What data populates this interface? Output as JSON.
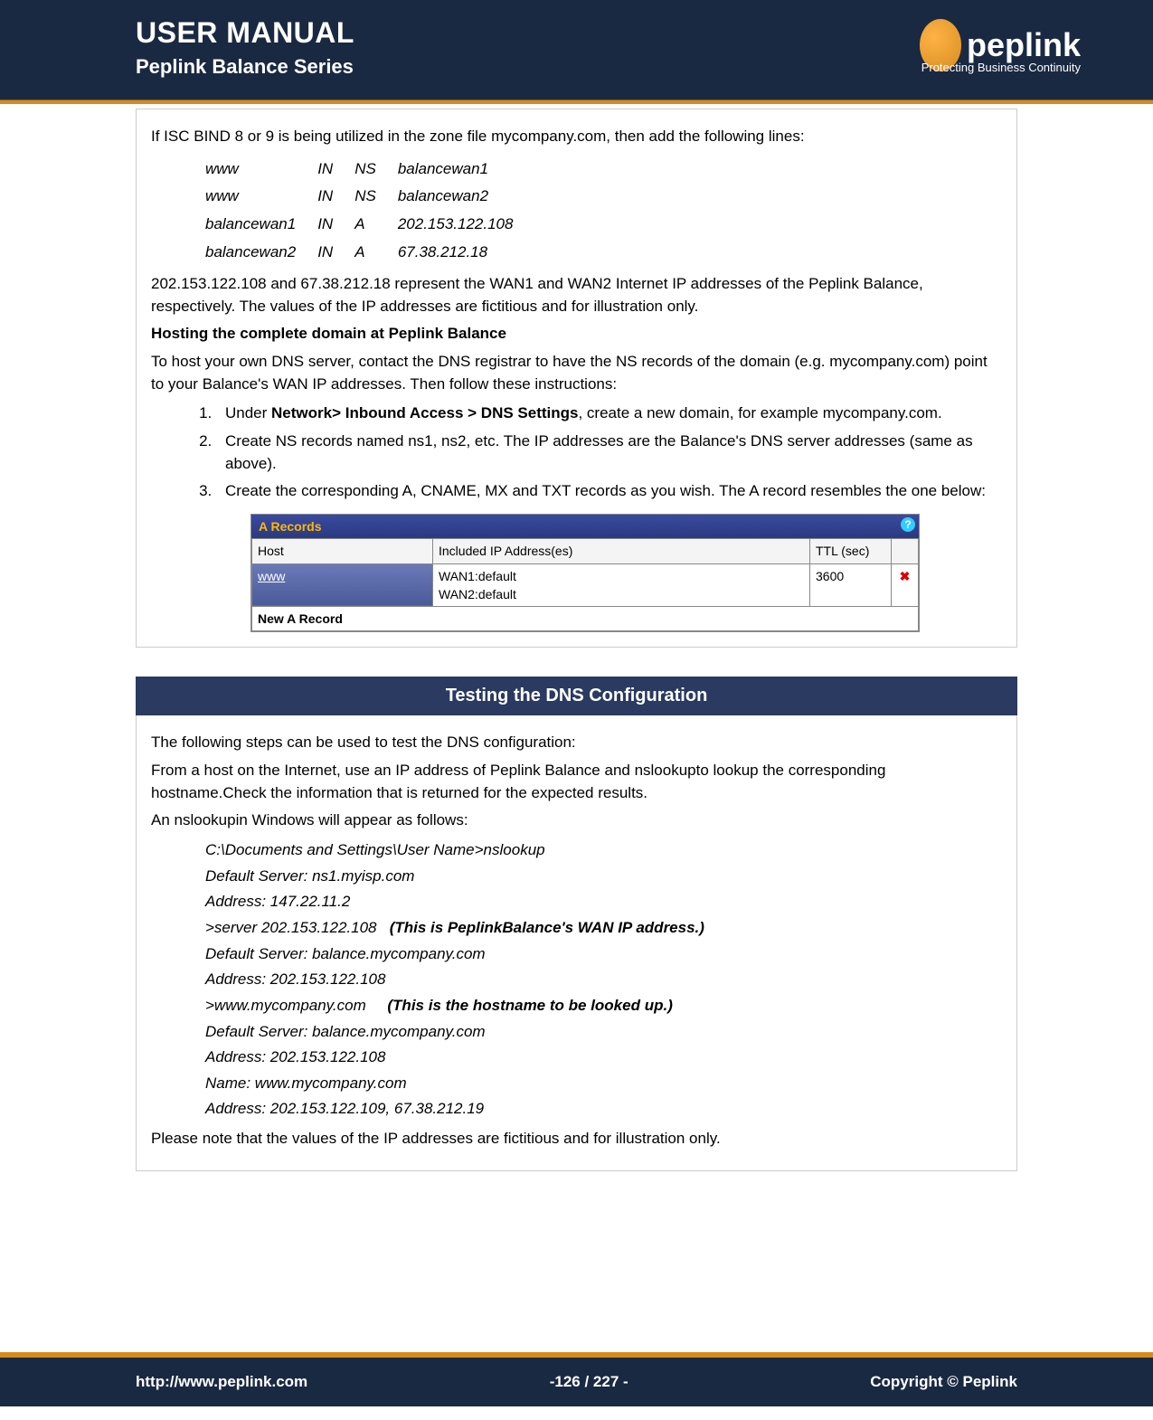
{
  "header": {
    "title": "USER MANUAL",
    "subtitle": "Peplink Balance Series",
    "logo_text": "peplink",
    "logo_tagline": "Protecting Business Continuity"
  },
  "box1": {
    "intro": "If ISC BIND 8 or 9 is being utilized in the zone file mycompany.com, then add the following lines:",
    "bind_rows": [
      {
        "host": "www",
        "in": "IN",
        "type": "NS",
        "val": "balancewan1"
      },
      {
        "host": "www",
        "in": "IN",
        "type": "NS",
        "val": "balancewan2"
      },
      {
        "host": "balancewan1",
        "in": "IN",
        "type": "A",
        "val": "202.153.122.108"
      },
      {
        "host": "balancewan2",
        "in": "IN",
        "type": "A",
        "val": "67.38.212.18"
      }
    ],
    "after_table": "202.153.122.108 and 67.38.212.18 represent the WAN1 and WAN2 Internet IP addresses of the Peplink Balance, respectively. The values of the IP addresses are fictitious and for illustration only.",
    "subheading": "Hosting the complete domain at Peplink Balance",
    "subintro": "To host your own DNS server, contact the DNS registrar to have the NS records of the domain (e.g. mycompany.com) point to your Balance's WAN IP addresses. Then follow these instructions:",
    "steps": {
      "s1_pre": "Under ",
      "s1_bold": "Network> Inbound Access > DNS Settings",
      "s1_post": ", create a new domain, for example mycompany.com.",
      "s2": "Create NS records named ns1, ns2, etc. The IP addresses are the Balance's DNS server addresses (same as above).",
      "s3": "Create the corresponding A, CNAME, MX and TXT records as you wish. The A record resembles the one below:"
    },
    "arec": {
      "title": "A Records",
      "col_host": "Host",
      "col_ip": "Included IP Address(es)",
      "col_ttl": "TTL (sec)",
      "row_host": "www",
      "row_ip": "WAN1:default\nWAN2:default",
      "row_ttl": "3600",
      "new_btn": "New A Record",
      "help": "?"
    }
  },
  "banner2": "Testing the DNS Configuration",
  "box2": {
    "p1": "The following steps can be used to test the DNS configuration:",
    "p2": "From a host on the Internet, use an IP address of Peplink Balance and nslookupto lookup the corresponding hostname.Check the information that is returned for the expected results.",
    "p3": "An nslookupin Windows will appear as follows:",
    "ns": {
      "l1": "C:\\Documents and Settings\\User Name>nslookup",
      "l2": "Default Server:  ns1.myisp.com",
      "l3": "Address:  147.22.11.2",
      "l4a": ">server 202.153.122.108",
      "l4b": "(This is PeplinkBalance's WAN IP address.)",
      "l5": "Default Server:  balance.mycompany.com",
      "l6": "Address:  202.153.122.108",
      "l7a": ">www.mycompany.com",
      "l7b": "(This is the hostname to be looked up.)",
      "l8": "Default Server:  balance.mycompany.com",
      "l9": "Address:  202.153.122.108",
      "l10": "Name:    www.mycompany.com",
      "l11": "Address:  202.153.122.109, 67.38.212.19"
    },
    "p4": "Please note that the values of the IP addresses are fictitious and for illustration only."
  },
  "footer": {
    "left": "http://www.peplink.com",
    "center": "-126 / 227 -",
    "right": "Copyright ©  Peplink"
  }
}
